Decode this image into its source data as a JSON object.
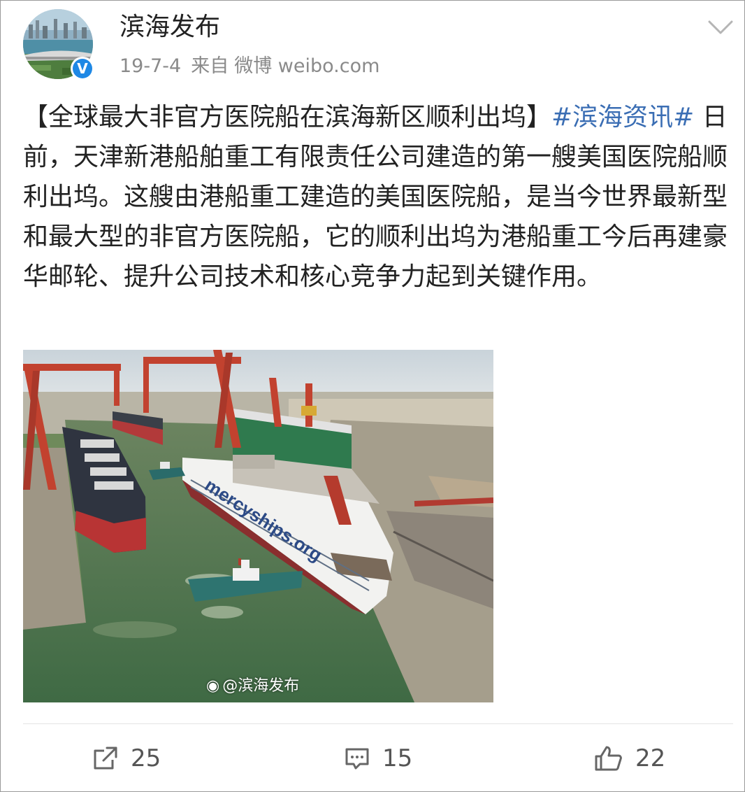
{
  "post": {
    "author": "滨海发布",
    "date": "19-7-4",
    "source_prefix": "来自",
    "source": "微博 weibo.com",
    "verified_mark": "V",
    "text_lead": "【全球最大非官方医院船在滨海新区顺利出坞】",
    "hashtag": "#滨海资讯#",
    "text_body": " 日前，天津新港船舶重工有限责任公司建造的第一艘美国医院船顺利出坞。这艘由港船重工建造的美国医院船，是当今世界最新型和最大型的非官方医院船，它的顺利出坞为港船重工今后再建豪华邮轮、提升公司技术和核心竞争力起到关键作用。",
    "image": {
      "ship_hull_text": "mercyships.org",
      "watermark": "@滨海发布"
    }
  },
  "actions": {
    "repost_count": "25",
    "comment_count": "15",
    "like_count": "22"
  },
  "icons": {
    "avatar": "avatar-image",
    "verified": "verified-badge-icon",
    "dropdown": "chevron-down-icon",
    "repost": "share-icon",
    "comment": "comment-icon",
    "like": "thumbs-up-icon",
    "weibo_logo": "weibo-logo-icon"
  },
  "colors": {
    "hashtag": "#3b6eb4",
    "verified": "#1e88e5",
    "meta_text": "#8a8a8a"
  }
}
